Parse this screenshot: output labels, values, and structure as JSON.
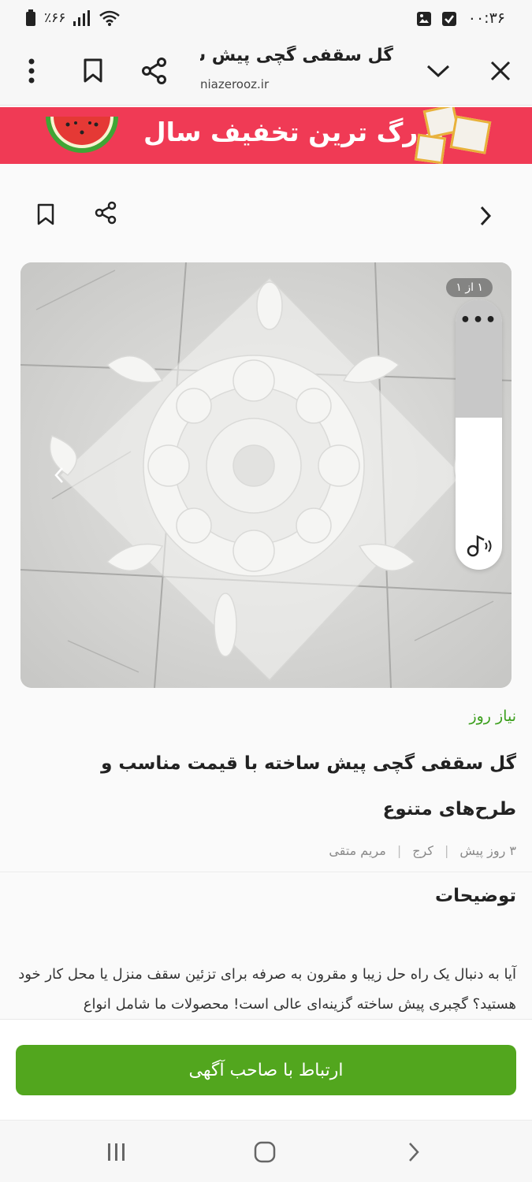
{
  "status_bar": {
    "time": "۰۰:۳۶",
    "battery_percent": "٪۶۶",
    "icons": [
      "gallery-icon",
      "check-icon",
      "wifi-icon",
      "signal-icon",
      "battery-icon"
    ]
  },
  "browser_bar": {
    "page_title": "گل سقفی گچی پیش سا...",
    "domain": "niazerooz.ir",
    "icons": [
      "close-icon",
      "chevron-down-icon",
      "share-icon",
      "bookmark-icon",
      "more-vert-icon"
    ]
  },
  "banner": {
    "text": "بزرگ ترین تخفیف سال",
    "icons": [
      "watermelon-icon",
      "gift-icon"
    ]
  },
  "page_actions": {
    "icons": [
      "bookmark-icon",
      "share-icon",
      "chevron-right-icon"
    ]
  },
  "gallery": {
    "counter": "۱ از ۱",
    "icons": [
      "chevron-left-icon"
    ]
  },
  "side_panel": {
    "more_label": "•••",
    "icons": [
      "audio-icon"
    ]
  },
  "article": {
    "source": "نیاز روز",
    "title": "گل سقفی گچی پیش ساخته با قیمت مناسب و طرح‌های متنوع",
    "meta": [
      "۳ روز پیش",
      "کرج",
      "مریم متقی"
    ],
    "description_heading": "توضیحات",
    "description": "آیا به دنبال یک راه حل زیبا و مقرون به صرفه برای تزئین سقف منزل یا محل کار خود هستید؟ گچبری پیش ساخته گزینه‌ای عالی است! محصولات ما شامل انواع"
  },
  "cta": {
    "label": "ارتباط با صاحب آگهی",
    "color": "#52a61e"
  },
  "nav_bar": {
    "icons": [
      "recents-icon",
      "home-icon",
      "back-icon"
    ]
  },
  "colors": {
    "banner_bg": "#f03a55",
    "source_green": "#3c9f1d"
  }
}
